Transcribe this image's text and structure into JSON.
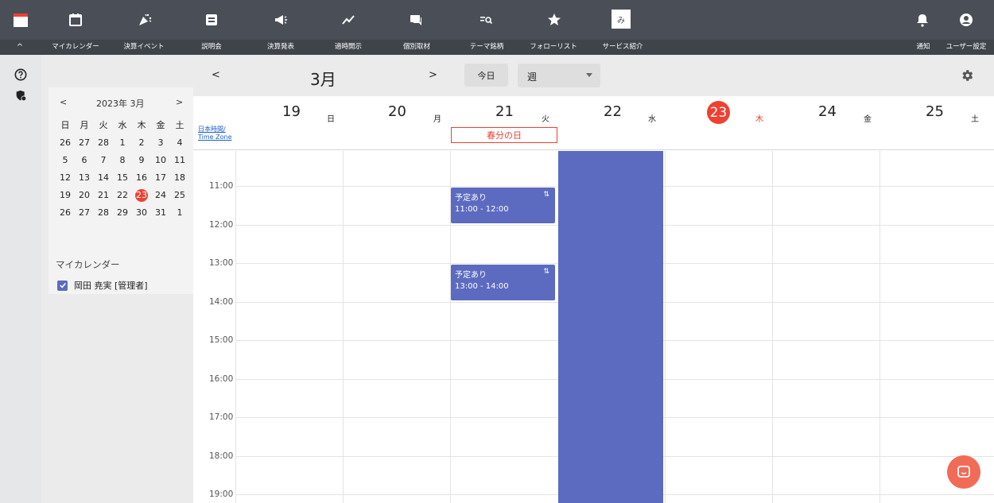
{
  "topnav": {
    "labels": {
      "collapse": "^",
      "my_calendar": "マイカレンダー",
      "earnings_event": "決算イベント",
      "briefing": "説明会",
      "earnings_release": "決算発表",
      "timely_disclosure": "適時開示",
      "individual_interview": "個別取材",
      "theme_stocks": "テーマ銘柄",
      "follow_list": "フォローリスト",
      "service_intro": "サービス紹介",
      "notifications": "通知",
      "user_settings": "ユーザー設定"
    },
    "avatar_letter": "み"
  },
  "header": {
    "prev": "<",
    "month_title": "3月",
    "next": ">",
    "today_button": "今日",
    "view_select": "週"
  },
  "mini_calendar": {
    "prev": "<",
    "title": "2023年 3月",
    "next": ">",
    "weekdays": [
      "日",
      "月",
      "火",
      "水",
      "木",
      "金",
      "土"
    ],
    "weeks": [
      [
        "26",
        "27",
        "28",
        "1",
        "2",
        "3",
        "4"
      ],
      [
        "5",
        "6",
        "7",
        "8",
        "9",
        "10",
        "11"
      ],
      [
        "12",
        "13",
        "14",
        "15",
        "16",
        "17",
        "18"
      ],
      [
        "19",
        "20",
        "21",
        "22",
        "23",
        "24",
        "25"
      ],
      [
        "26",
        "27",
        "28",
        "29",
        "30",
        "31",
        "1"
      ]
    ],
    "today": "23"
  },
  "my_calendars": {
    "title": "マイカレンダー",
    "items": [
      {
        "label": "岡田 尭実 [管理者]",
        "checked": true
      }
    ]
  },
  "timezone_link": {
    "line1": "日本時間/",
    "line2": "Time Zone"
  },
  "days": [
    {
      "num": "19",
      "wk": "日"
    },
    {
      "num": "20",
      "wk": "月"
    },
    {
      "num": "21",
      "wk": "火"
    },
    {
      "num": "22",
      "wk": "水"
    },
    {
      "num": "23",
      "wk": "木",
      "today": true
    },
    {
      "num": "24",
      "wk": "金"
    },
    {
      "num": "25",
      "wk": "土"
    }
  ],
  "holiday": "春分の日",
  "time_labels": [
    "11:00",
    "12:00",
    "13:00",
    "14:00",
    "15:00",
    "16:00",
    "17:00",
    "18:00",
    "19:00"
  ],
  "events": [
    {
      "title": "予定あり",
      "time": "11:00 - 12:00"
    },
    {
      "title": "予定あり",
      "time": "13:00 - 14:00"
    }
  ],
  "colors": {
    "event": "#5c6bc0",
    "today": "#ef4030",
    "topbar": "#4a4f57"
  }
}
